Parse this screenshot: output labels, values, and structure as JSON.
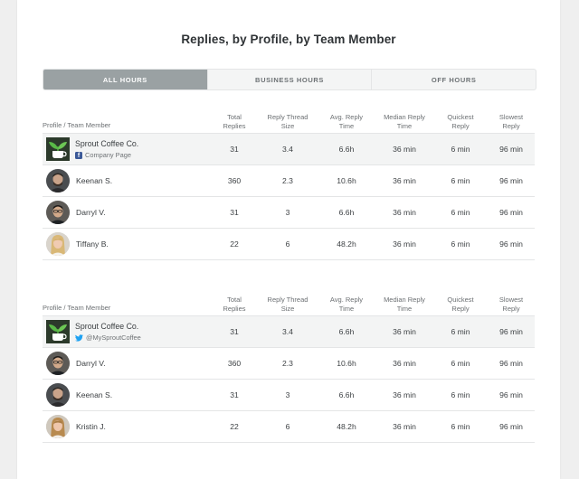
{
  "report": {
    "title": "Replies, by Profile, by Team Member"
  },
  "tabs": [
    {
      "label": "ALL HOURS",
      "active": true
    },
    {
      "label": "BUSINESS HOURS",
      "active": false
    },
    {
      "label": "OFF HOURS",
      "active": false
    }
  ],
  "columns": {
    "profile": "Profile / Team Member",
    "total_replies": [
      "Total",
      "Replies"
    ],
    "thread_size": [
      "Reply Thread",
      "Size"
    ],
    "avg_reply": [
      "Avg. Reply",
      "Time"
    ],
    "median_reply": [
      "Median Reply",
      "Time"
    ],
    "quickest": [
      "Quickest",
      "Reply"
    ],
    "slowest": [
      "Slowest",
      "Reply"
    ]
  },
  "tables": [
    {
      "profile": {
        "name": "Sprout Coffee Co.",
        "network": "facebook",
        "network_icon": "facebook-icon",
        "handle": "Company Page",
        "stats": [
          "31",
          "3.4",
          "6.6h",
          "36 min",
          "6 min",
          "96 min"
        ]
      },
      "members": [
        {
          "name": "Keenan S.",
          "stats": [
            "360",
            "2.3",
            "10.6h",
            "36 min",
            "6 min",
            "96 min"
          ]
        },
        {
          "name": "Darryl V.",
          "stats": [
            "31",
            "3",
            "6.6h",
            "36 min",
            "6 min",
            "96 min"
          ]
        },
        {
          "name": "Tiffany B.",
          "stats": [
            "22",
            "6",
            "48.2h",
            "36 min",
            "6 min",
            "96 min"
          ]
        }
      ]
    },
    {
      "profile": {
        "name": "Sprout Coffee Co.",
        "network": "twitter",
        "network_icon": "twitter-icon",
        "handle": "@MySproutCoffee",
        "stats": [
          "31",
          "3.4",
          "6.6h",
          "36 min",
          "6 min",
          "96 min"
        ]
      },
      "members": [
        {
          "name": "Darryl V.",
          "stats": [
            "360",
            "2.3",
            "10.6h",
            "36 min",
            "6 min",
            "96 min"
          ]
        },
        {
          "name": "Keenan S.",
          "stats": [
            "31",
            "3",
            "6.6h",
            "36 min",
            "6 min",
            "96 min"
          ]
        },
        {
          "name": "Kristin J.",
          "stats": [
            "22",
            "6",
            "48.2h",
            "36 min",
            "6 min",
            "96 min"
          ]
        }
      ]
    }
  ],
  "colors": {
    "active_tab": "#9aa1a3",
    "facebook": "#3b5998",
    "twitter": "#1da1f2",
    "logo_leaf": "#59b947"
  }
}
